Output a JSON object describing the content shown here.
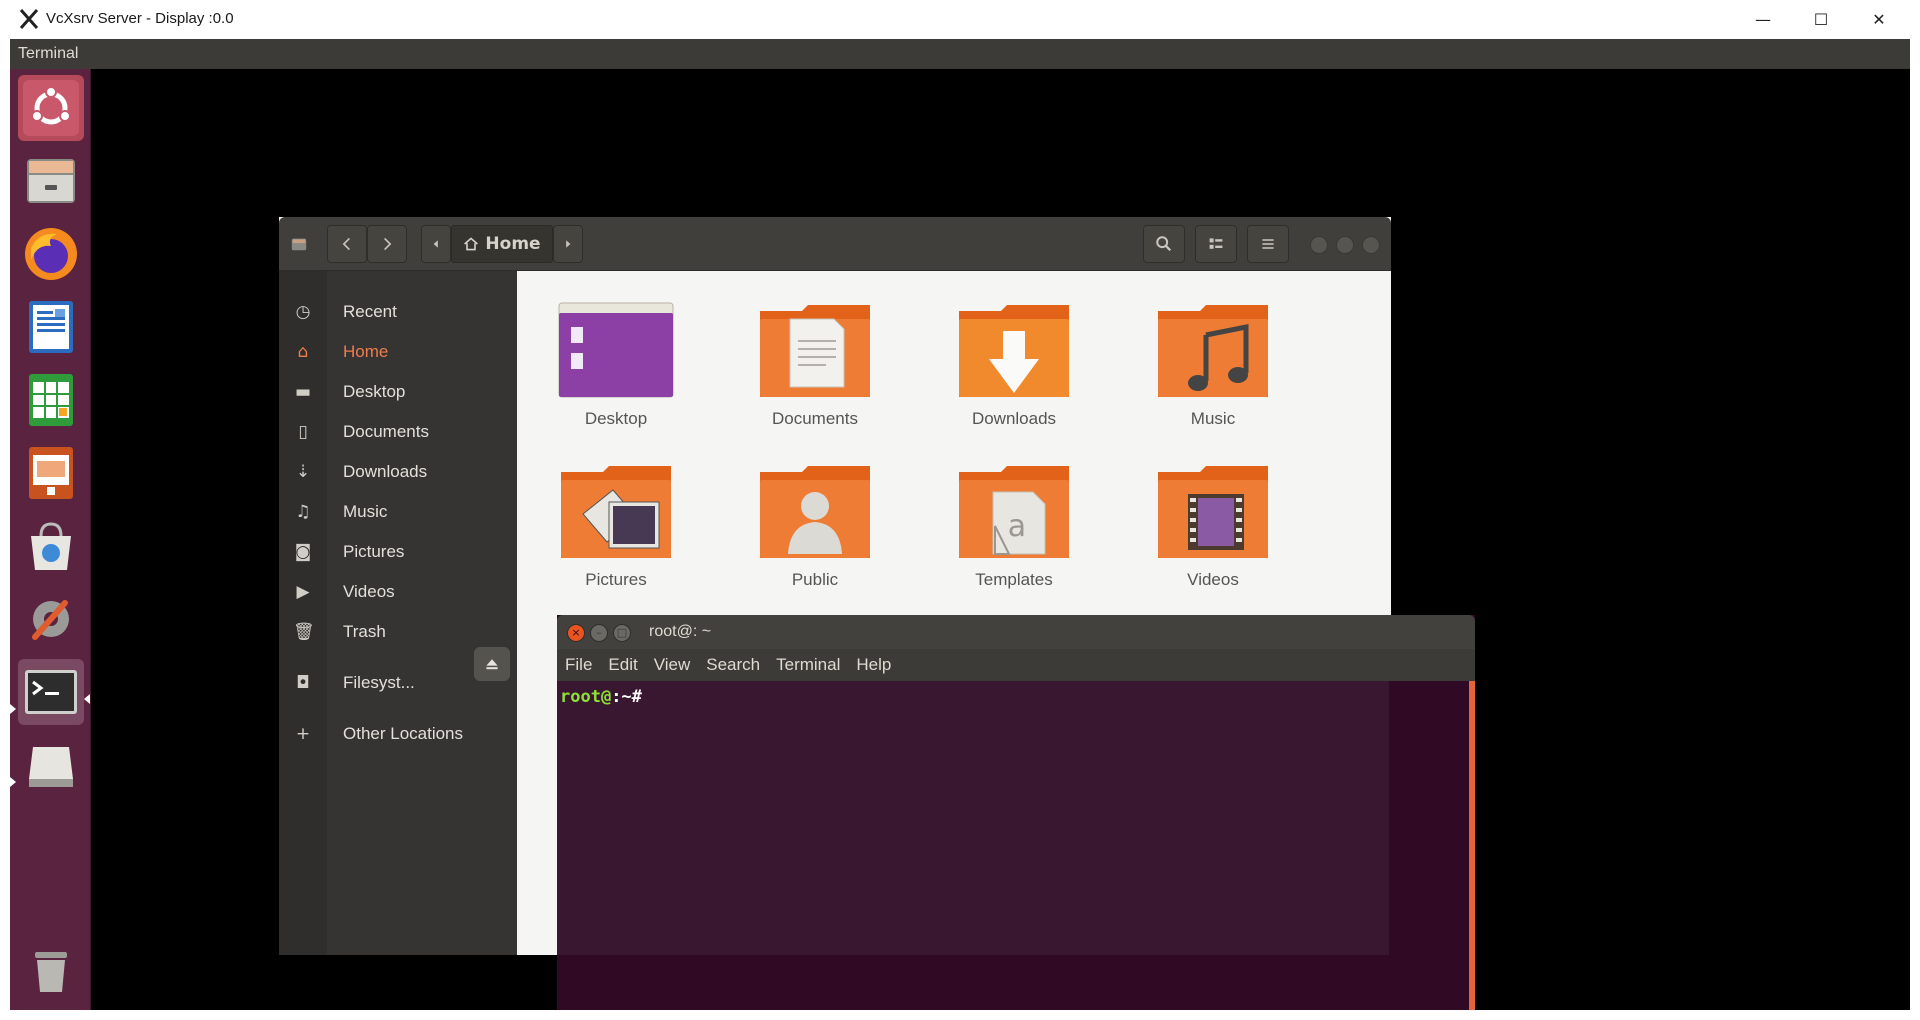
{
  "host": {
    "title": "VcXsrv Server - Display :0.0",
    "controls": {
      "minimize": "—",
      "maximize": "☐",
      "close": "✕"
    }
  },
  "top_panel": {
    "app_name": "Terminal"
  },
  "launcher": {
    "items": [
      {
        "name": "ubuntu-dash-icon"
      },
      {
        "name": "files-icon"
      },
      {
        "name": "firefox-icon"
      },
      {
        "name": "libreoffice-writer-icon"
      },
      {
        "name": "libreoffice-calc-icon"
      },
      {
        "name": "libreoffice-impress-icon"
      },
      {
        "name": "software-center-icon"
      },
      {
        "name": "system-settings-icon"
      },
      {
        "name": "terminal-icon"
      },
      {
        "name": "drive-icon"
      },
      {
        "name": "trash-icon"
      }
    ]
  },
  "files": {
    "path": {
      "home_label": "Home"
    },
    "sidebar": [
      {
        "label": "Recent",
        "icon": "clock-icon"
      },
      {
        "label": "Home",
        "icon": "home-icon",
        "active": true
      },
      {
        "label": "Desktop",
        "icon": "folder-icon"
      },
      {
        "label": "Documents",
        "icon": "document-icon"
      },
      {
        "label": "Downloads",
        "icon": "download-icon"
      },
      {
        "label": "Music",
        "icon": "music-icon"
      },
      {
        "label": "Pictures",
        "icon": "camera-icon"
      },
      {
        "label": "Videos",
        "icon": "video-icon"
      },
      {
        "label": "Trash",
        "icon": "trash-icon"
      },
      {
        "label": "Filesyst...",
        "icon": "disk-icon"
      },
      {
        "label": "Other Locations",
        "icon": "plus-icon"
      }
    ],
    "folders": [
      {
        "label": "Desktop"
      },
      {
        "label": "Documents"
      },
      {
        "label": "Downloads"
      },
      {
        "label": "Music"
      },
      {
        "label": "Pictures"
      },
      {
        "label": "Public"
      },
      {
        "label": "Templates"
      },
      {
        "label": "Videos"
      }
    ]
  },
  "terminal": {
    "title": "root@: ~",
    "menu": [
      "File",
      "Edit",
      "View",
      "Search",
      "Terminal",
      "Help"
    ],
    "prompt_user": "root@",
    "prompt_path": ":~#"
  },
  "colors": {
    "launcher_bg": "#5a2340",
    "accent": "#f07c4c",
    "terminal_bg": "#300a24",
    "prompt_green": "#8ae234"
  }
}
